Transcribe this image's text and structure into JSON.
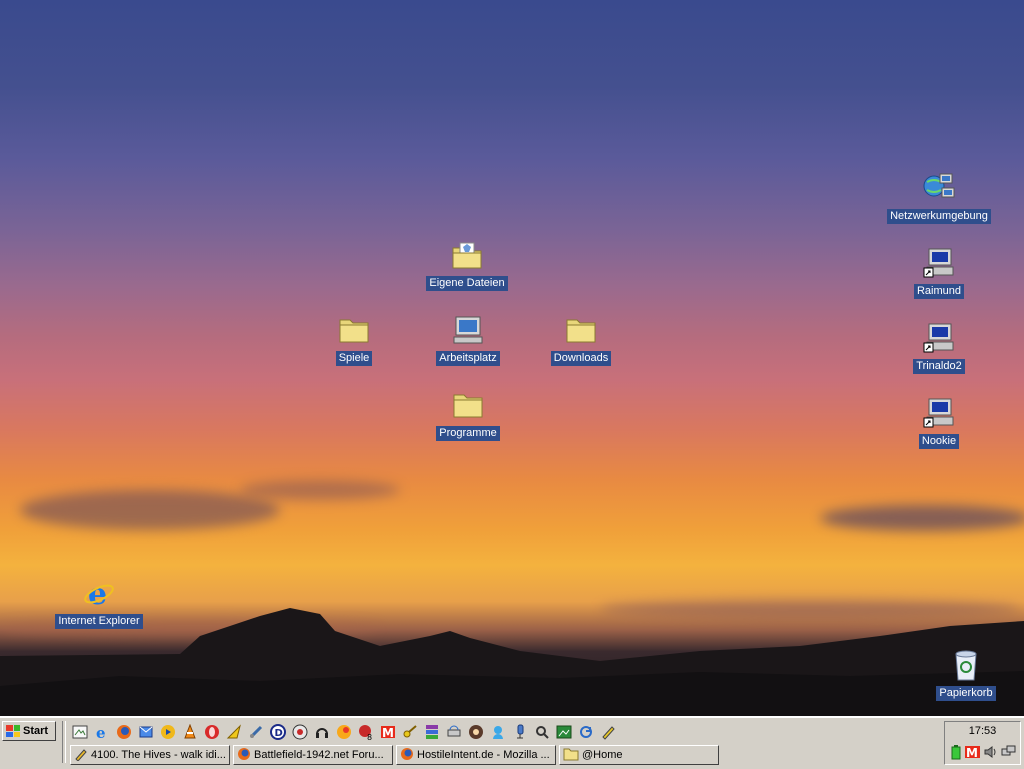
{
  "desktop": {
    "icons": {
      "eigene_dateien": "Eigene Dateien",
      "spiele": "Spiele",
      "arbeitsplatz": "Arbeitsplatz",
      "downloads": "Downloads",
      "programme": "Programme",
      "netzwerk": "Netzwerkumgebung",
      "raimund": "Raimund",
      "trinaldo2": "Trinaldo2",
      "nookie": "Nookie",
      "internet_explorer": "Internet Explorer",
      "papierkorb": "Papierkorb"
    }
  },
  "taskbar": {
    "start_label": "Start",
    "quick_launch": [
      "show-desktop",
      "internet-explorer",
      "firefox",
      "outlook-express",
      "media-player",
      "vlc",
      "opera",
      "winamp",
      "network-tool",
      "d-tool",
      "audio-tool",
      "headset",
      "weather",
      "gmail",
      "keys",
      "winrar",
      "network-drive",
      "recorder",
      "messenger",
      "microphone",
      "search",
      "picture",
      "refresh",
      "pen"
    ],
    "tasks": [
      {
        "label": "4100. The Hives - walk idi...",
        "icon": "pencil-icon"
      },
      {
        "label": "Battlefield-1942.net Foru...",
        "icon": "firefox-icon"
      },
      {
        "label": "HostileIntent.de - Mozilla ...",
        "icon": "firefox-icon"
      },
      {
        "label": "@Home",
        "icon": "folder-icon"
      }
    ],
    "tray": {
      "clock": "17:53"
    }
  },
  "colors": {
    "label_bg": "#2f4e8c",
    "taskbar": "#d4d0c8"
  }
}
